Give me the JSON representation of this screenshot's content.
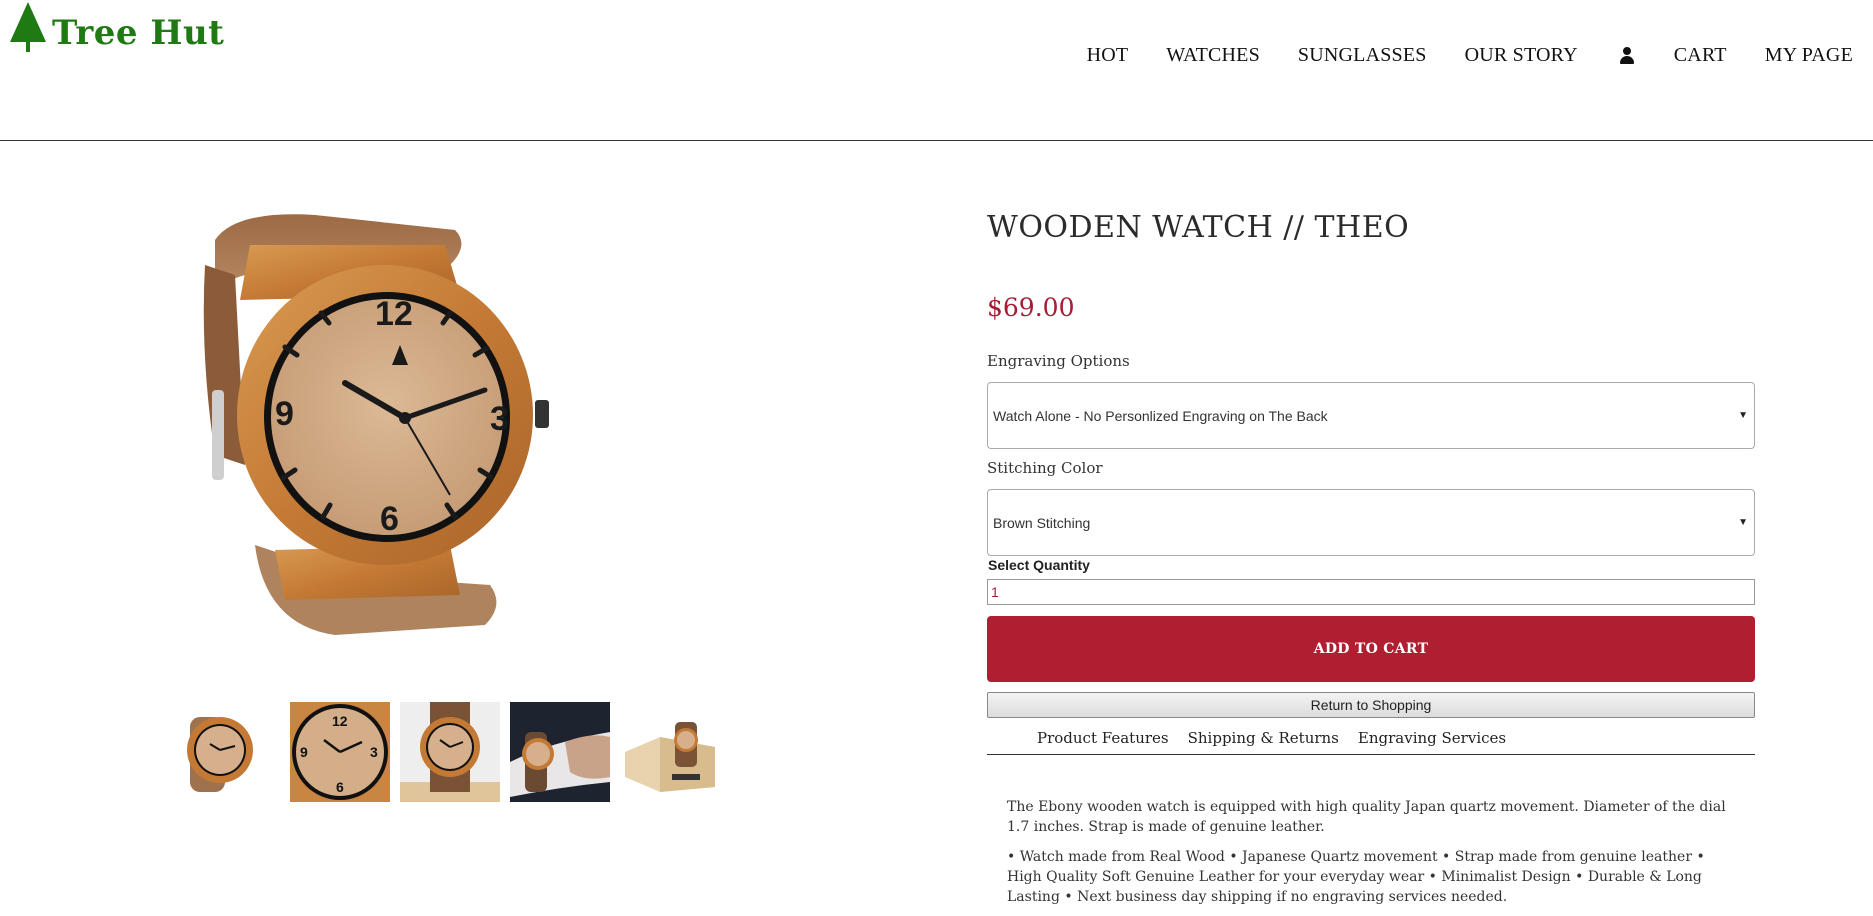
{
  "header": {
    "logo_text": "Tree Hut",
    "nav": [
      {
        "label": "HOT"
      },
      {
        "label": "WATCHES"
      },
      {
        "label": "SUNGLASSES"
      },
      {
        "label": "OUR STORY"
      },
      {
        "label": "CART"
      },
      {
        "label": "MY PAGE"
      }
    ],
    "user_icon": "user-icon"
  },
  "product": {
    "title": "WOODEN WATCH // THEO",
    "price": "$69.00",
    "engraving": {
      "label": "Engraving Options",
      "selected": "Watch Alone - No Personlized Engraving on The Back"
    },
    "stitching": {
      "label": "Stitching Color",
      "selected": "Brown Stitching"
    },
    "quantity": {
      "label": "Select Quantity",
      "value": "1"
    },
    "add_to_cart": "ADD TO CART",
    "return_to_shopping": "Return to Shopping",
    "tabs": [
      {
        "label": "Product Features"
      },
      {
        "label": "Shipping & Returns"
      },
      {
        "label": "Engraving Services"
      }
    ],
    "description": [
      "The Ebony wooden watch is equipped with high quality Japan quartz movement. Diameter of the dial 1.7 inches. Strap is made of genuine leather.",
      "• Watch made from Real Wood • Japanese Quartz movement • Strap made from genuine leather • High Quality Soft Genuine Leather for your everyday wear • Minimalist Design • Durable & Long Lasting • Next business day shipping if no engraving services needed."
    ]
  },
  "colors": {
    "brand_green": "#1f7a14",
    "accent_red": "#b01e32",
    "price_red": "#a81c33"
  }
}
